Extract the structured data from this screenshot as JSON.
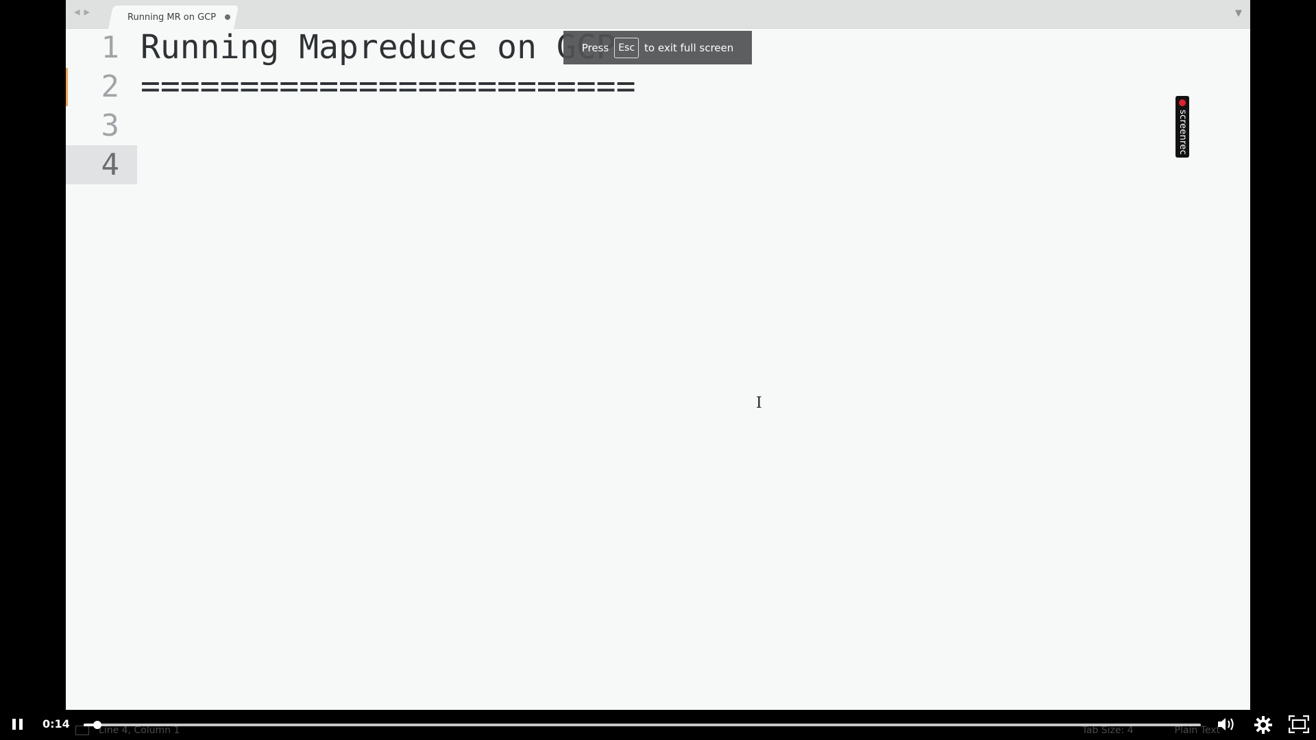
{
  "tab": {
    "title": "Running MR on GCP"
  },
  "editor": {
    "lines": [
      {
        "number": "1",
        "text": "Running Mapreduce on GCP"
      },
      {
        "number": "2",
        "text": "========================="
      },
      {
        "number": "3",
        "text": ""
      },
      {
        "number": "4",
        "text": ""
      }
    ],
    "active_line": 4
  },
  "fullscreen_notice": {
    "prefix": "Press",
    "key": "Esc",
    "suffix": "to exit full screen"
  },
  "screenrec": {
    "label": "screenrec"
  },
  "status_bar": {
    "position": "Line 4, Column 1",
    "tab_size": "Tab Size: 4",
    "syntax": "Plain Text"
  },
  "player": {
    "time": "0:14",
    "progress_fraction": 0.012,
    "play_state": "playing"
  },
  "icons": {
    "pause": "pause-icon",
    "volume": "volume-icon",
    "settings": "gear-icon",
    "fullscreen": "fullscreen-exit-icon",
    "tab_modified": "unsaved-dot-icon",
    "dropdown": "chevron-down-icon"
  },
  "colors": {
    "modified_marker": "#f6a24b",
    "rec_dot": "#e0202a"
  }
}
